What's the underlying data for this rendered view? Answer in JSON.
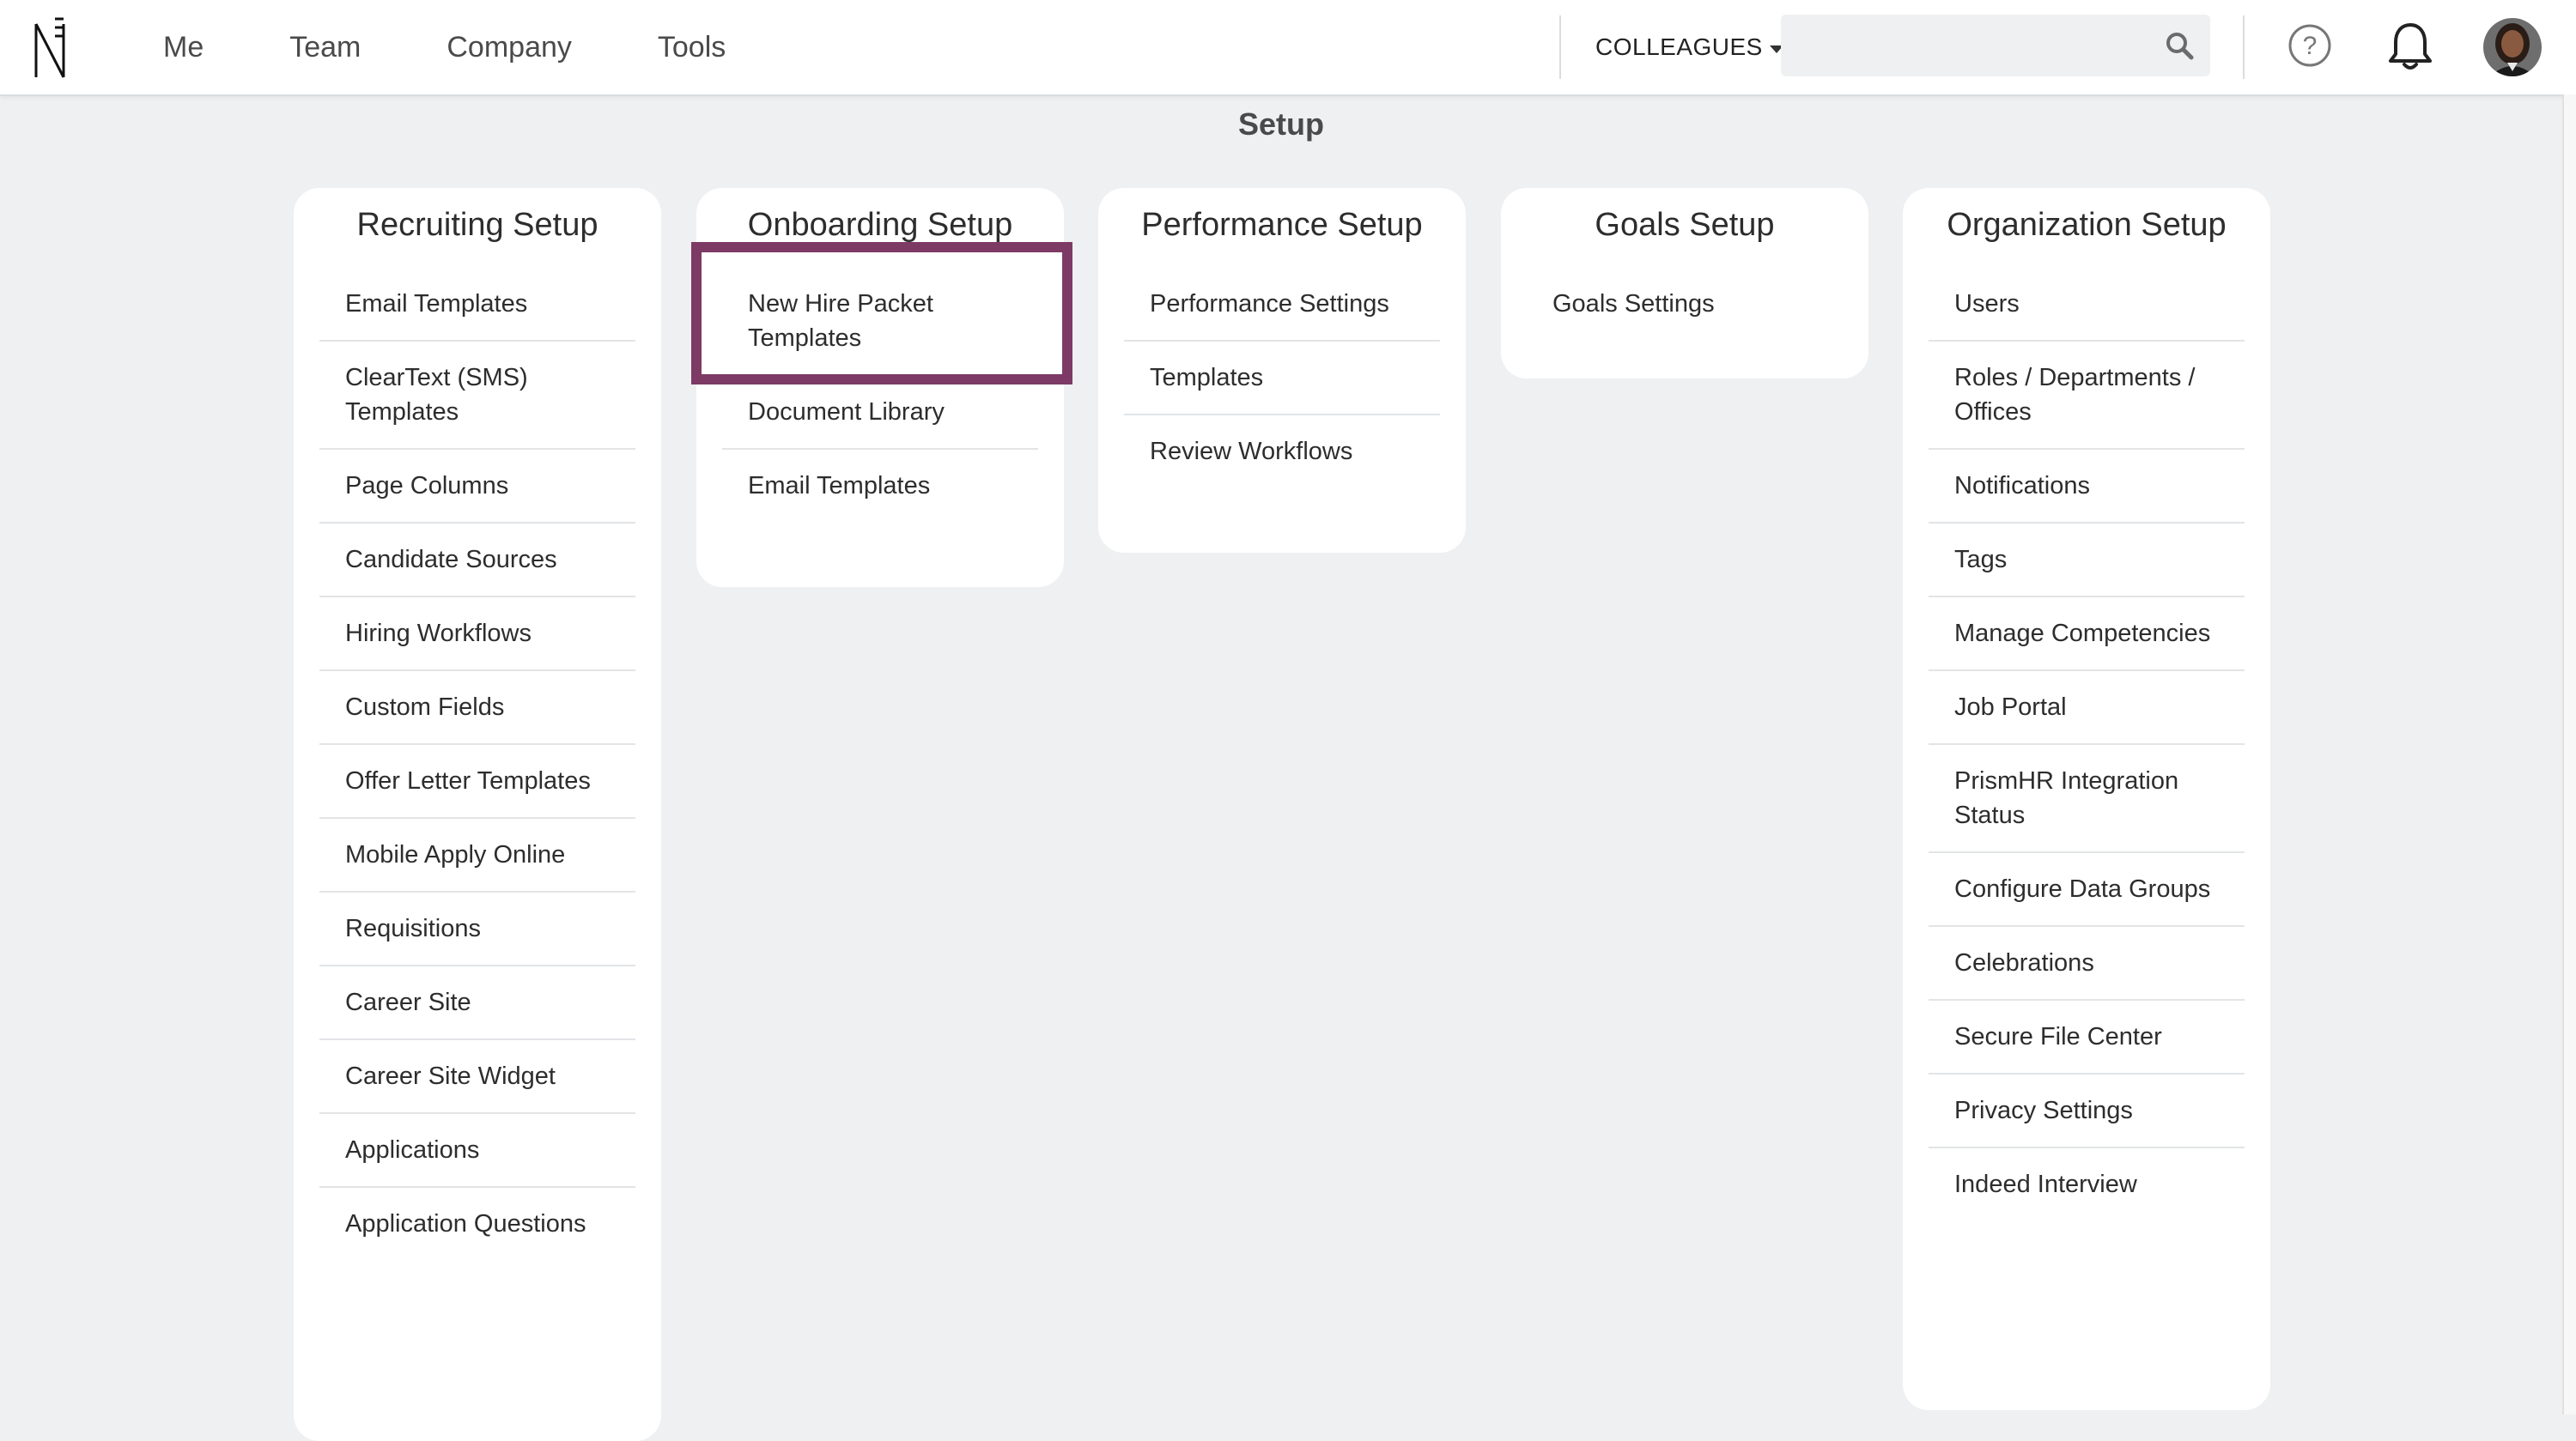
{
  "nav": {
    "items": [
      "Me",
      "Team",
      "Company",
      "Tools"
    ],
    "colleagues_label": "COLLEAGUES",
    "search_placeholder": "",
    "search_value": ""
  },
  "page": {
    "title": "Setup"
  },
  "cards": {
    "recruiting": {
      "title": "Recruiting Setup",
      "items": [
        "Email Templates",
        "ClearText (SMS) Templates",
        "Page Columns",
        "Candidate Sources",
        "Hiring Workflows",
        "Custom Fields",
        "Offer Letter Templates",
        "Mobile Apply Online",
        "Requisitions",
        "Career Site",
        "Career Site Widget",
        "Applications",
        "Application Questions"
      ]
    },
    "onboarding": {
      "title": "Onboarding Setup",
      "items": [
        "New Hire Packet Templates",
        "Document Library",
        "Email Templates"
      ]
    },
    "performance": {
      "title": "Performance Setup",
      "items": [
        "Performance Settings",
        "Templates",
        "Review Workflows"
      ]
    },
    "goals": {
      "title": "Goals Setup",
      "items": [
        "Goals Settings"
      ]
    },
    "organization": {
      "title": "Organization Setup",
      "items": [
        "Users",
        "Roles / Departments / Offices",
        "Notifications",
        "Tags",
        "Manage Competencies",
        "Job Portal",
        "PrismHR Integration Status",
        "Configure Data Groups",
        "Celebrations",
        "Secure File Center",
        "Privacy Settings",
        "Indeed Interview"
      ]
    }
  },
  "icons": {
    "logo": "namely-logo",
    "search": "search-icon",
    "help": "help-circle-icon",
    "notifications": "bell-icon",
    "avatar": "user-avatar"
  },
  "colors": {
    "highlight": "#7d3a65",
    "background": "#eef0f2",
    "card": "#ffffff"
  }
}
